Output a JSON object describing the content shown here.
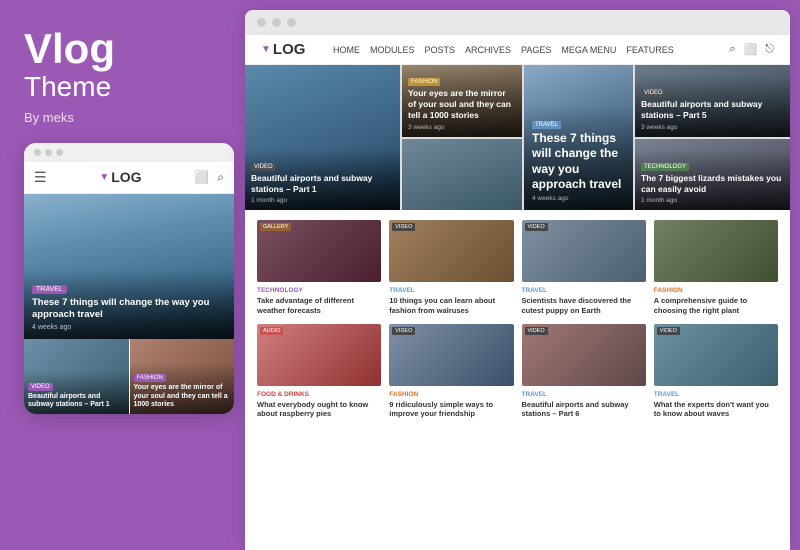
{
  "leftPanel": {
    "title": "Vlog",
    "subtitle": "Theme",
    "by": "By meks"
  },
  "mobile": {
    "logo": "LOG",
    "logoV": "▼",
    "heroTag": "TRAVEL",
    "heroTitle": "These 7 things will change the way you approach travel",
    "heroDate": "4 weeks ago",
    "grid": [
      {
        "tag": "VIDEO",
        "title": "Beautiful airports and subway stations – Part 1"
      },
      {
        "tag": "FASHION",
        "title": "Your eyes are the mirror of your soul and they can tell a 1000 stories"
      }
    ]
  },
  "browser": {
    "logo": "LOG",
    "logoV": "▼",
    "nav": [
      {
        "label": "HOME"
      },
      {
        "label": "MODULES"
      },
      {
        "label": "POSTS"
      },
      {
        "label": "ARCHIVES"
      },
      {
        "label": "PAGES"
      },
      {
        "label": "MEGA MENU"
      },
      {
        "label": "FEATURES"
      }
    ],
    "heroCards": [
      {
        "tag": "VIDEO",
        "title": "Beautiful airports and subway stations – Part 1",
        "date": "1 month ago"
      },
      {
        "tag": "FASHION",
        "title": "Your eyes are the mirror of your soul and they can tell a 1000 stories",
        "date": "3 weeks ago"
      },
      {
        "tag": "TRAVEL",
        "title": "These 7 things will change the way you approach travel",
        "date": "4 weeks ago"
      },
      {
        "tag": "VIDEO",
        "title": "Beautiful airports and subway stations – Part 5",
        "date": "3 weeks ago"
      },
      {
        "tag": "TECHNOLOGY",
        "title": "The 7 biggest lizards mistakes you can easily avoid",
        "date": "1 month ago"
      }
    ],
    "gridRow1": [
      {
        "thumbClass": "gt1",
        "thumbTag": "GALLERY",
        "thumbTagClass": "gallery",
        "category": "TECHNOLOGY",
        "categoryClass": "tech",
        "title": "Take advantage of different weather forecasts"
      },
      {
        "thumbClass": "gt2",
        "thumbTag": "VIDEO",
        "thumbTagClass": "video",
        "category": "TRAVEL",
        "categoryClass": "travel",
        "title": "10 things you can learn about fashion from walruses"
      },
      {
        "thumbClass": "gt3",
        "thumbTag": "VIDEO",
        "thumbTagClass": "video",
        "category": "TRAVEL",
        "categoryClass": "travel",
        "title": "Scientists have discovered the cutest puppy on Earth"
      },
      {
        "thumbClass": "gt4",
        "thumbTag": "",
        "thumbTagClass": "",
        "category": "FASHION",
        "categoryClass": "fashion",
        "title": "A comprehensive guide to choosing the right plant"
      }
    ],
    "gridRow2": [
      {
        "thumbClass": "gt5",
        "thumbTag": "AUDIO",
        "thumbTagClass": "audio",
        "category": "FOOD & DRINKS",
        "categoryClass": "food",
        "title": "What everybody ought to know about raspberry pies"
      },
      {
        "thumbClass": "gt6",
        "thumbTag": "VIDEO",
        "thumbTagClass": "video",
        "category": "FASHION",
        "categoryClass": "fashion",
        "title": "9 ridiculously simple ways to improve your friendship"
      },
      {
        "thumbClass": "gt7",
        "thumbTag": "VIDEO",
        "thumbTagClass": "video",
        "category": "TRAVEL",
        "categoryClass": "travel",
        "title": "Beautiful airports and subway stations – Part 6"
      },
      {
        "thumbClass": "gt8",
        "thumbTag": "VIDEO",
        "thumbTagClass": "video",
        "category": "TRAVEL",
        "categoryClass": "travel",
        "title": "What the experts don't want you to know about waves"
      }
    ]
  },
  "colors": {
    "purple": "#9b59b6"
  }
}
